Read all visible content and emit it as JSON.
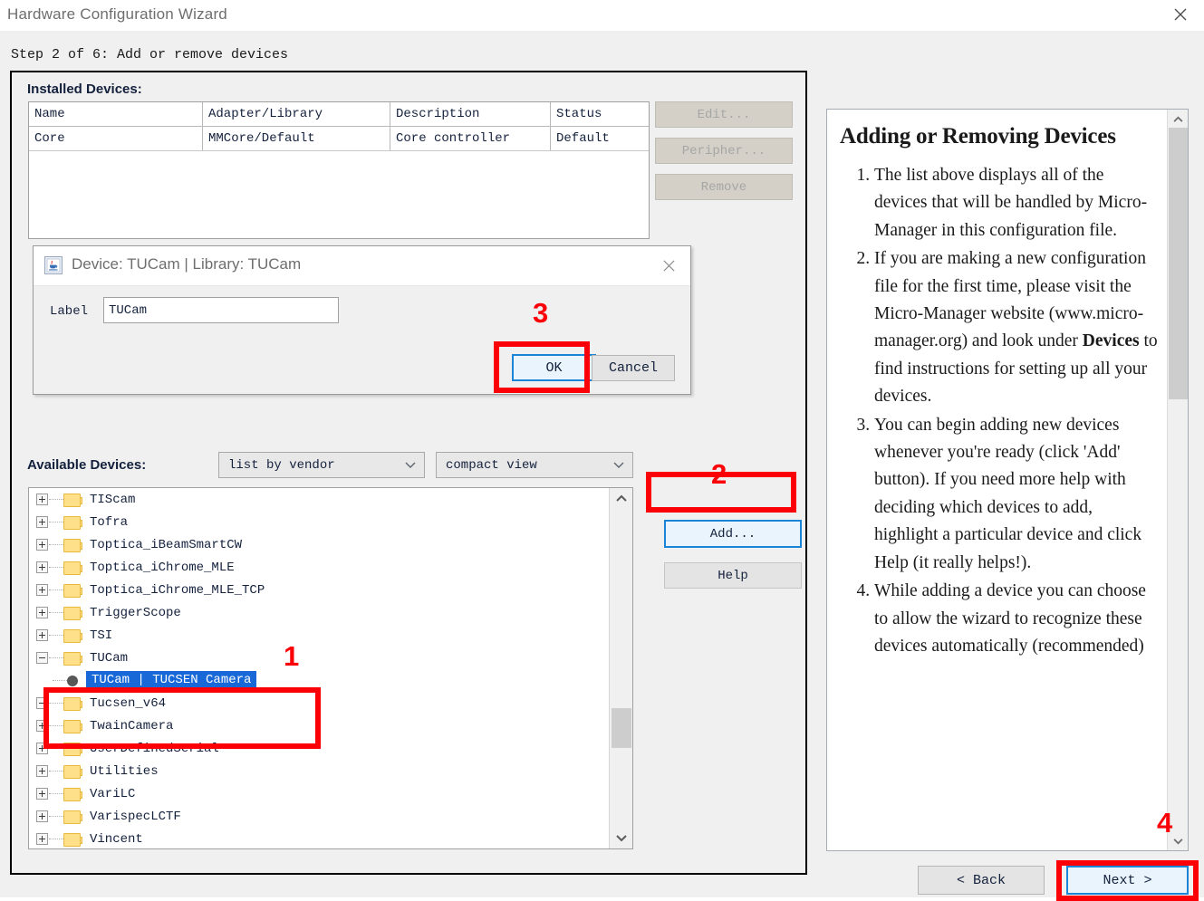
{
  "window": {
    "title": "Hardware Configuration Wizard",
    "close_icon": "close-icon"
  },
  "wizard": {
    "step_label": "Step 2 of 6: Add or remove devices",
    "installed_devices_label": "Installed Devices:",
    "available_devices_label": "Available Devices:"
  },
  "installed_table": {
    "columns": [
      "Name",
      "Adapter/Library",
      "Description",
      "Status"
    ],
    "rows": [
      [
        "Core",
        "MMCore/Default",
        "Core controller",
        "Default"
      ]
    ]
  },
  "side_buttons": [
    {
      "label": "Edit...",
      "name": "edit-button",
      "enabled": false
    },
    {
      "label": "Peripher...",
      "name": "peripheral-button",
      "enabled": false
    },
    {
      "label": "Remove",
      "name": "remove-button",
      "enabled": false
    }
  ],
  "filters": {
    "grouping": {
      "selected": "list by vendor"
    },
    "view": {
      "selected": "compact view"
    }
  },
  "device_tree": [
    {
      "label": "TIScam",
      "type": "folder",
      "expanded": false
    },
    {
      "label": "Tofra",
      "type": "folder",
      "expanded": false
    },
    {
      "label": "Toptica_iBeamSmartCW",
      "type": "folder",
      "expanded": false
    },
    {
      "label": "Toptica_iChrome_MLE",
      "type": "folder",
      "expanded": false
    },
    {
      "label": "Toptica_iChrome_MLE_TCP",
      "type": "folder",
      "expanded": false
    },
    {
      "label": "TriggerScope",
      "type": "folder",
      "expanded": false
    },
    {
      "label": "TSI",
      "type": "folder",
      "expanded": false
    },
    {
      "label": "TUCam",
      "type": "folder",
      "expanded": true
    },
    {
      "label": "TUCam  |  TUCSEN Camera",
      "type": "leaf",
      "selected": true
    },
    {
      "label": "Tucsen_v64",
      "type": "folder",
      "expanded": true
    },
    {
      "label": "TwainCamera",
      "type": "folder",
      "expanded": false
    },
    {
      "label": "UserDefinedSerial",
      "type": "folder",
      "expanded": false
    },
    {
      "label": "Utilities",
      "type": "folder",
      "expanded": false
    },
    {
      "label": "VariLC",
      "type": "folder",
      "expanded": false
    },
    {
      "label": "VarispecLCTF",
      "type": "folder",
      "expanded": false
    },
    {
      "label": "Vincent",
      "type": "folder",
      "expanded": false
    }
  ],
  "action_buttons": {
    "add": "Add...",
    "help": "Help"
  },
  "help_panel": {
    "title": "Adding or Removing Devices",
    "items": [
      {
        "text_before": "The list above displays all of the devices that will be handled by Micro-Manager in this configuration file."
      },
      {
        "text_before": "If you are making a new configuration file for the first time, please visit the Micro-Manager website (www.micro-manager.org) and look under ",
        "bold": "Devices",
        "text_after": " to find instructions for setting up all your devices."
      },
      {
        "text_before": "You can begin adding new devices whenever you're ready (click 'Add' button). If you need more help with deciding which devices to add, highlight a particular device and click Help (it really helps!)."
      },
      {
        "text_before": "While adding a device you can choose to allow the wizard to recognize these devices automatically (recommended)"
      }
    ]
  },
  "nav": {
    "back": "< Back",
    "next": "Next >"
  },
  "modal": {
    "title": "Device: TUCam | Library: TUCam",
    "app_icon": "java-app-icon",
    "close_icon": "close-icon",
    "label_caption": "Label",
    "label_value": "TUCam",
    "ok": "OK",
    "cancel": "Cancel"
  },
  "annotations": [
    {
      "number": "1"
    },
    {
      "number": "2"
    },
    {
      "number": "3"
    },
    {
      "number": "4"
    }
  ]
}
